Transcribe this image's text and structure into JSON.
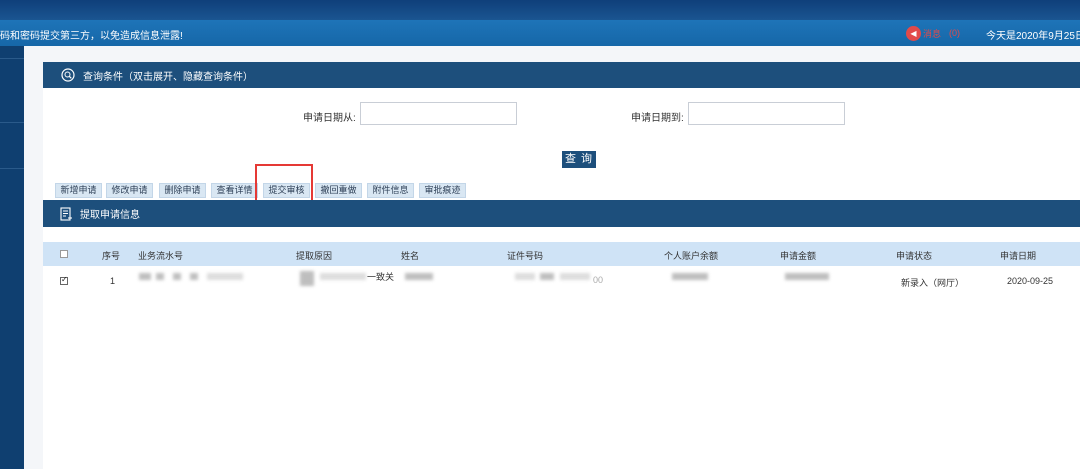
{
  "notice": {
    "text": "码和密码提交第三方，以免造成信息泄露!",
    "message_label": "消息",
    "message_count": "(0)",
    "today": "今天是2020年9月25日"
  },
  "query": {
    "title": "查询条件（双击展开、隐藏查询条件）",
    "date_from_label": "申请日期从:",
    "date_from_value": "",
    "date_to_label": "申请日期到:",
    "date_to_value": "",
    "search_label": "查 询"
  },
  "toolbar": {
    "buttons": [
      "新增申请",
      "修改申请",
      "删除申请",
      "查看详情",
      "提交审核",
      "撤回重做",
      "附件信息",
      "审批痕迹"
    ]
  },
  "list": {
    "title": "提取申请信息",
    "columns": [
      "序号",
      "业务流水号",
      "提取原因",
      "姓名",
      "证件号码",
      "个人账户余额",
      "申请金额",
      "申请状态",
      "申请日期"
    ],
    "rows": [
      {
        "checked": true,
        "index": "1",
        "serial": "",
        "reason_fragment": "一致关",
        "name_fragment": "",
        "id_fragment": "00",
        "balance": "",
        "amount": "",
        "status": "新录入（网厅）",
        "date": "2020-09-25"
      }
    ]
  },
  "icons": {
    "query_icon": "search-icon",
    "list_icon": "document-list-icon",
    "message_icon": "message-icon"
  },
  "colors": {
    "header_dark": "#1d4f7c",
    "notice_bar": "#1e74b8",
    "column_header": "#cfe3f6",
    "toolbar_button": "#d9e7f3",
    "highlight": "#e53935"
  }
}
